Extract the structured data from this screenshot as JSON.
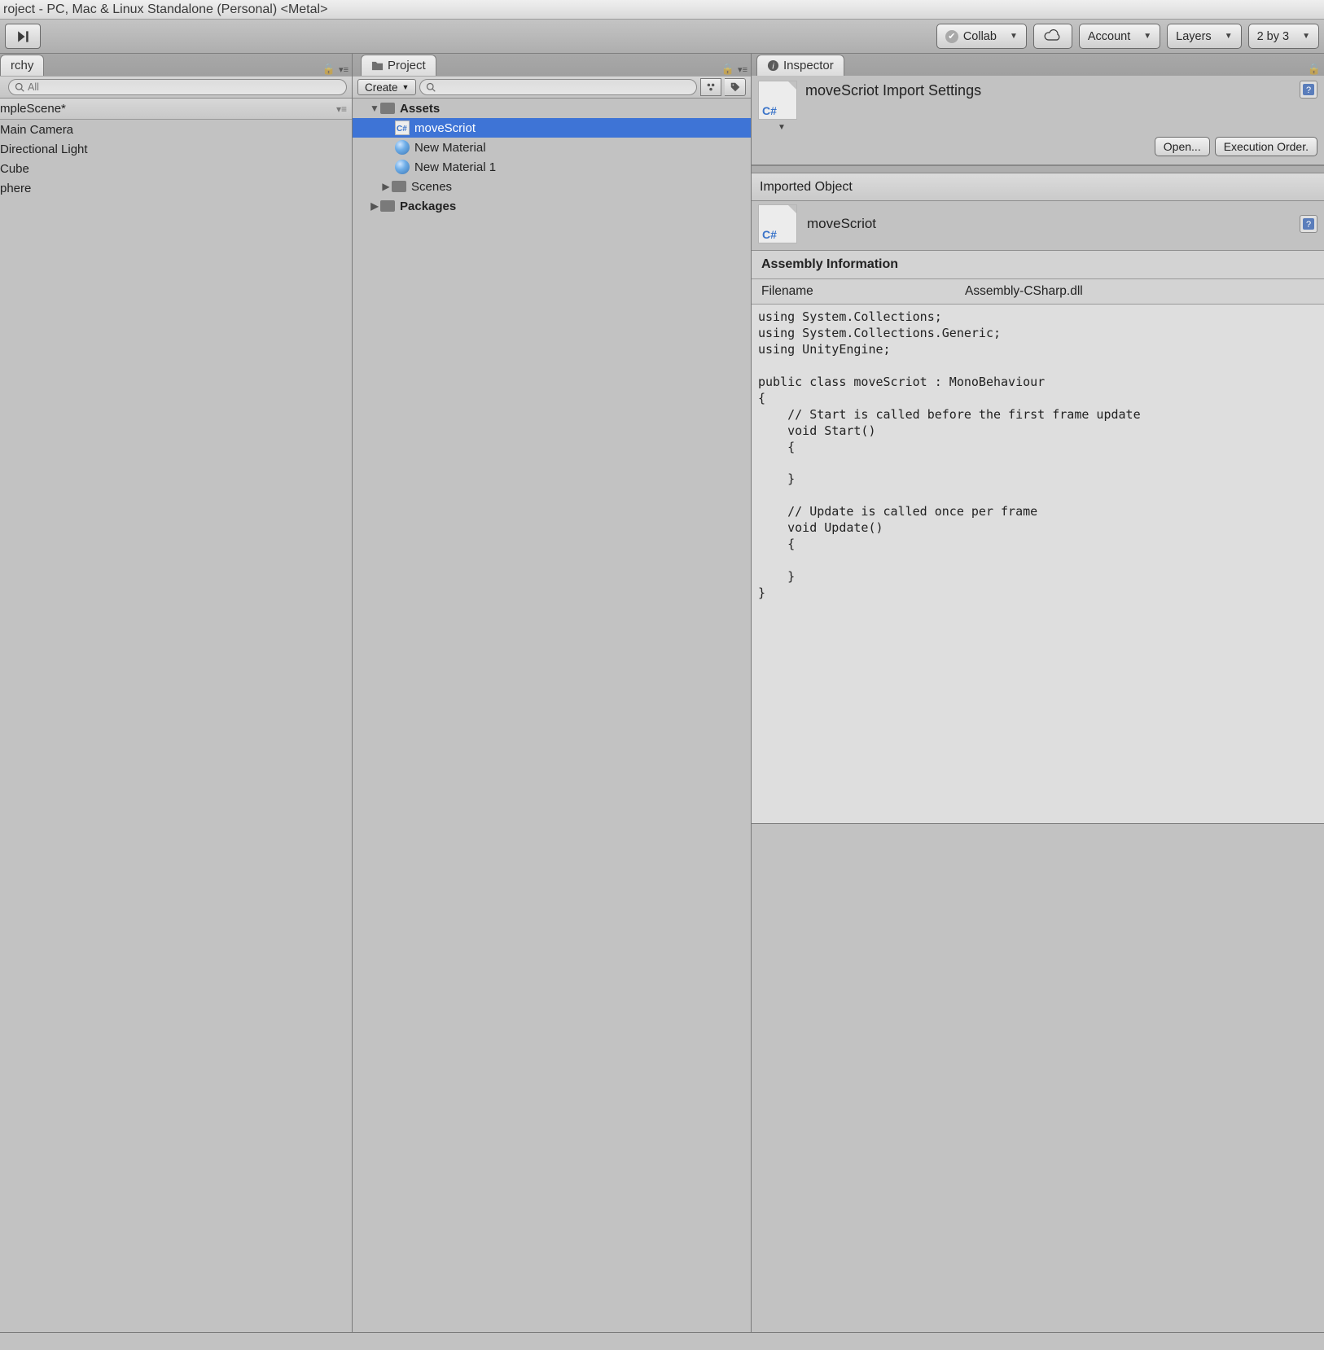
{
  "title_bar": "roject - PC, Mac & Linux Standalone (Personal) <Metal>",
  "toolbar": {
    "collab": "Collab",
    "account": "Account",
    "layers": "Layers",
    "layout": "2 by 3"
  },
  "hierarchy": {
    "tab_label": "rchy",
    "search_placeholder": "All",
    "scene": "mpleScene*",
    "items": [
      "Main Camera",
      "Directional Light",
      "Cube",
      "phere"
    ]
  },
  "project": {
    "tab_label": "Project",
    "create_label": "Create",
    "root_assets": "Assets",
    "items": [
      {
        "type": "cs",
        "label": "moveScriot",
        "selected": true
      },
      {
        "type": "mat",
        "label": "New Material"
      },
      {
        "type": "mat",
        "label": "New Material 1"
      },
      {
        "type": "folder",
        "label": "Scenes",
        "expandable": true
      }
    ],
    "packages": "Packages"
  },
  "inspector": {
    "tab_label": "Inspector",
    "title": "moveScriot Import Settings",
    "open_btn": "Open...",
    "exec_btn": "Execution Order.",
    "imported_object": "Imported Object",
    "object_name": "moveScriot",
    "assembly_header": "Assembly Information",
    "filename_key": "Filename",
    "filename_val": "Assembly-CSharp.dll",
    "code": "using System.Collections;\nusing System.Collections.Generic;\nusing UnityEngine;\n\npublic class moveScriot : MonoBehaviour\n{\n    // Start is called before the first frame update\n    void Start()\n    {\n        \n    }\n\n    // Update is called once per frame\n    void Update()\n    {\n        \n    }\n}"
  }
}
